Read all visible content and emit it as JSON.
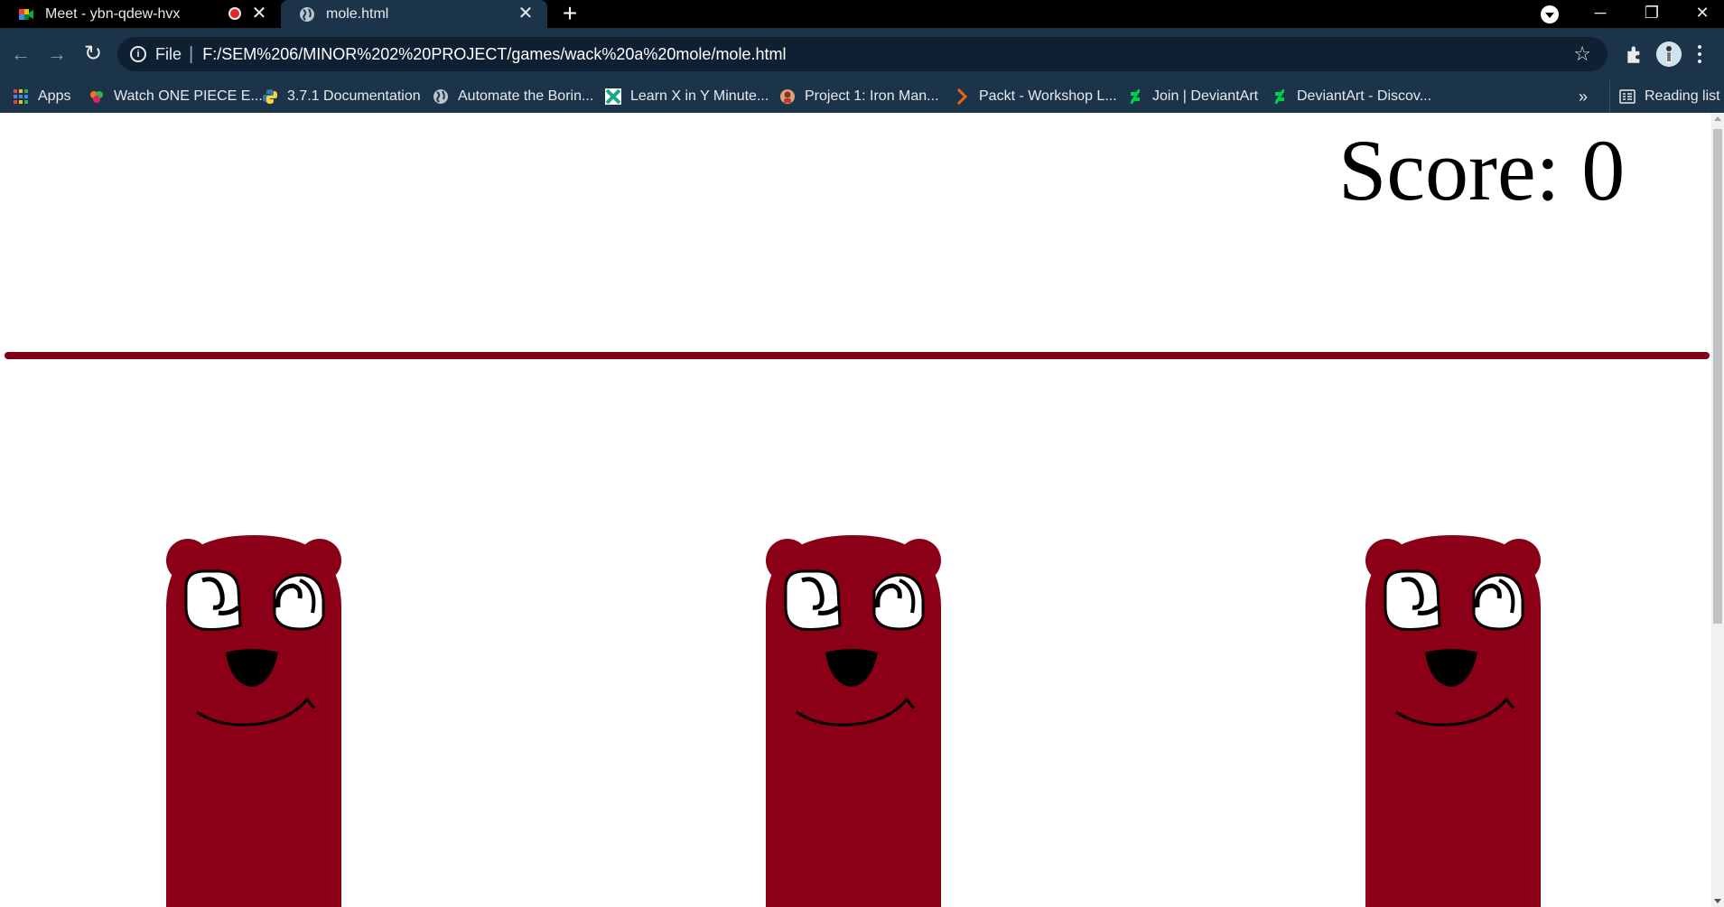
{
  "browser": {
    "tabs": [
      {
        "title": "Meet - ybn-qdew-hvx",
        "favicon": "google-meet-icon",
        "recording": true,
        "active": false
      },
      {
        "title": "mole.html",
        "favicon": "globe-icon",
        "active": true
      }
    ],
    "new_tab_label": "+",
    "window_buttons": {
      "minimize": "─",
      "maximize": "❐",
      "close": "✕"
    },
    "address": {
      "scheme_label": "File",
      "separator": "|",
      "url": "F:/SEM%206/MINOR%202%20PROJECT/games/wack%20a%20mole/mole.html"
    },
    "bookmarks": [
      {
        "label": "Apps",
        "icon": "apps-grid-icon"
      },
      {
        "label": "Watch ONE PIECE E...",
        "icon": "crunchy-icon"
      },
      {
        "label": "3.7.1 Documentation",
        "icon": "python-icon"
      },
      {
        "label": "Automate the Borin...",
        "icon": "globe-icon"
      },
      {
        "label": "Learn X in Y Minute...",
        "icon": "x-minutes-icon"
      },
      {
        "label": "Project 1: Iron Man...",
        "icon": "ironman-icon"
      },
      {
        "label": "Packt - Workshop L...",
        "icon": "packt-icon"
      },
      {
        "label": "Join | DeviantArt",
        "icon": "deviantart-icon"
      },
      {
        "label": "DeviantArt - Discov...",
        "icon": "deviantart-icon"
      }
    ],
    "bookmarks_overflow": "»",
    "reading_list_label": "Reading list"
  },
  "game": {
    "score_label": "Score:",
    "score_value": "0",
    "mole_count": 3,
    "colors": {
      "mole": "#8b0016",
      "ground": "#7d0019",
      "chrome": "#1b3449"
    }
  }
}
